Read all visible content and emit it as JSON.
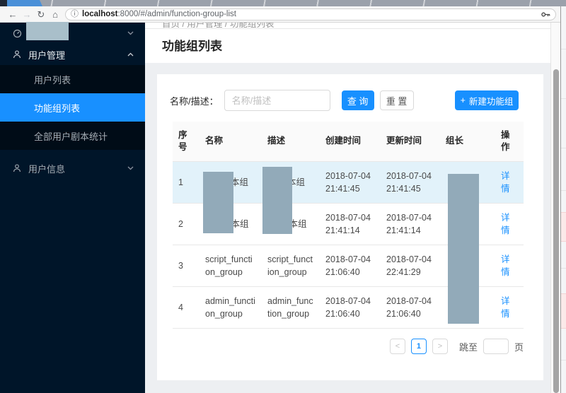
{
  "browser": {
    "url_host": "localhost",
    "url_rest": ":8000/#/admin/function-group-list",
    "back": "←",
    "forward": "→",
    "reload": "↻",
    "home": "⌂",
    "info": "ⓘ"
  },
  "sidebar": {
    "user_mgmt": "用户管理",
    "submenu": [
      "用户列表",
      "功能组列表",
      "全部用户剧本统计"
    ],
    "user_info": "用户信息"
  },
  "page": {
    "breadcrumb": "首页 / 用户管理 / 功能组列表",
    "title": "功能组列表"
  },
  "search": {
    "label": "名称/描述：",
    "placeholder": "名称/描述",
    "query": "查 询",
    "reset": "重 置",
    "create_plus": "+",
    "create": "新建功能组"
  },
  "table": {
    "headers": [
      "序号",
      "名称",
      "描述",
      "创建时间",
      "更新时间",
      "组长",
      "操作"
    ],
    "rows": [
      {
        "no": "1",
        "name": "本组",
        "desc": "本组",
        "created": "2018-07-04 21:41:45",
        "updated": "2018-07-04 21:41:45",
        "leader": "",
        "action": "详情"
      },
      {
        "no": "2",
        "name": "剧本组",
        "desc": "剧本组",
        "created": "2018-07-04 21:41:14",
        "updated": "2018-07-04 21:41:14",
        "leader": "",
        "action": "详情"
      },
      {
        "no": "3",
        "name": "script_function_group",
        "desc": "script_function_group",
        "created": "2018-07-04 21:06:40",
        "updated": "2018-07-04 22:41:29",
        "leader": "",
        "action": "详情"
      },
      {
        "no": "4",
        "name": "admin_function_group",
        "desc": "admin_function_group",
        "created": "2018-07-04 21:06:40",
        "updated": "2018-07-04 21:06:40",
        "leader": "",
        "action": "详情"
      }
    ]
  },
  "pagination": {
    "prev": "<",
    "page": "1",
    "next": ">",
    "jump_label": "跳至",
    "page_unit": "页"
  },
  "colors": {
    "accent": "#1890ff",
    "sidebar_bg": "#001529",
    "submenu_bg": "#000c17",
    "redaction": "#92aab9",
    "redaction_light": "#a9bfca",
    "row_highlight": "#e2f2fa"
  }
}
